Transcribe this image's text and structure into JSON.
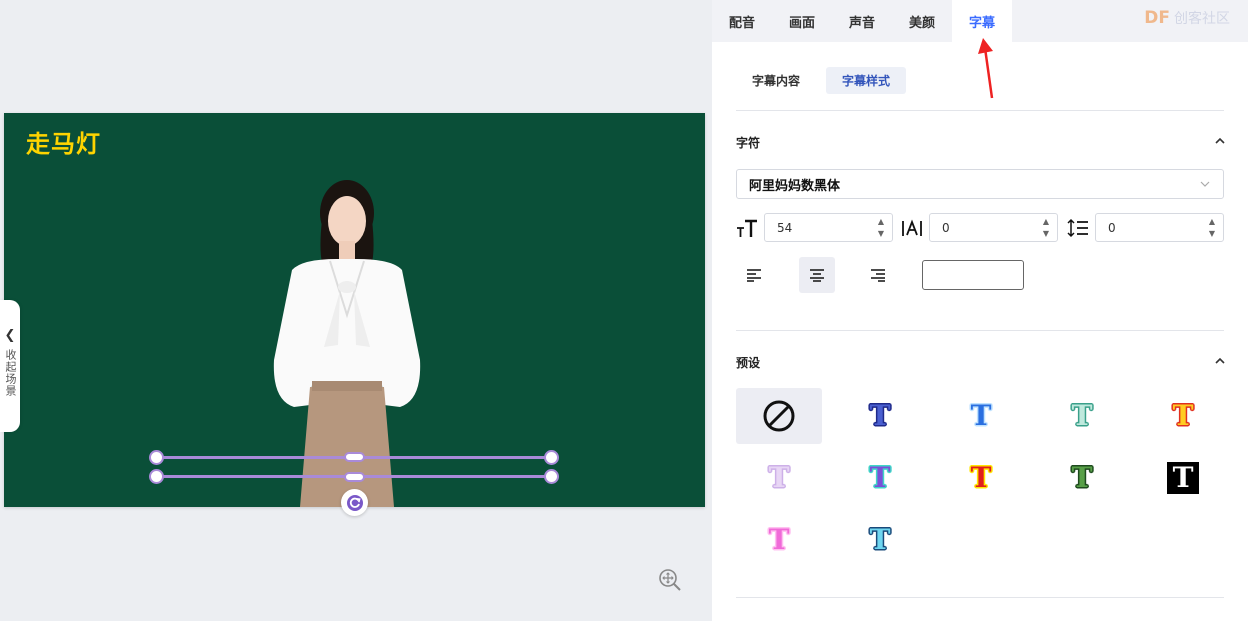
{
  "canvas": {
    "title": "走马灯",
    "collapse_label": "收起场景",
    "zoom_icon": "zoom-icon"
  },
  "top_tabs": [
    {
      "label": "配音",
      "active": false
    },
    {
      "label": "画面",
      "active": false
    },
    {
      "label": "声音",
      "active": false
    },
    {
      "label": "美颜",
      "active": false
    },
    {
      "label": "字幕",
      "active": true
    }
  ],
  "brand": {
    "logo": "DF",
    "name": "创客社区"
  },
  "sub_tabs": [
    {
      "label": "字幕内容",
      "active": false
    },
    {
      "label": "字幕样式",
      "active": true
    }
  ],
  "font_section": {
    "title": "字符",
    "font_family": "阿里妈妈数黑体",
    "font_size": "54",
    "letter_spacing": "0",
    "line_spacing": "0",
    "alignment": "center"
  },
  "preset_section": {
    "title": "预设",
    "presets": [
      {
        "name": "none",
        "label": "",
        "fill": "",
        "stroke": ""
      },
      {
        "name": "blue-outline",
        "label": "T",
        "fill": "#4a5fd0",
        "stroke": "#1f2a8a"
      },
      {
        "name": "lightblue-glow",
        "label": "T",
        "fill": "#2a6fe0",
        "stroke": "#bfe2ff"
      },
      {
        "name": "mint-green",
        "label": "T",
        "fill": "#bfe9dd",
        "stroke": "#3aa08a"
      },
      {
        "name": "orange-red",
        "label": "T",
        "fill": "#ffcc22",
        "stroke": "#e03020"
      },
      {
        "name": "lavender",
        "label": "T",
        "fill": "#e8d6f5",
        "stroke": "#cdb0e8"
      },
      {
        "name": "purple-teal",
        "label": "T",
        "fill": "#7a50d8",
        "stroke": "#3fd6c8"
      },
      {
        "name": "red-yellow",
        "label": "T",
        "fill": "#e01e1e",
        "stroke": "#ffe600"
      },
      {
        "name": "green-dark",
        "label": "T",
        "fill": "#58a048",
        "stroke": "#1e4a1e"
      },
      {
        "name": "white-on-black",
        "label": "T",
        "fill": "#ffffff",
        "stroke": "#000000"
      },
      {
        "name": "pink-magenta",
        "label": "T",
        "fill": "#f06ad8",
        "stroke": "#ffc0f0"
      },
      {
        "name": "cyan-navy",
        "label": "T",
        "fill": "#6fd6f0",
        "stroke": "#1a4a7a"
      }
    ]
  },
  "colors": {
    "stage_bg": "#0a4f38",
    "title_color": "#ffd400",
    "selection": "#a98ad8",
    "accent": "#3b6cff",
    "annotation_arrow": "#ee2222"
  }
}
